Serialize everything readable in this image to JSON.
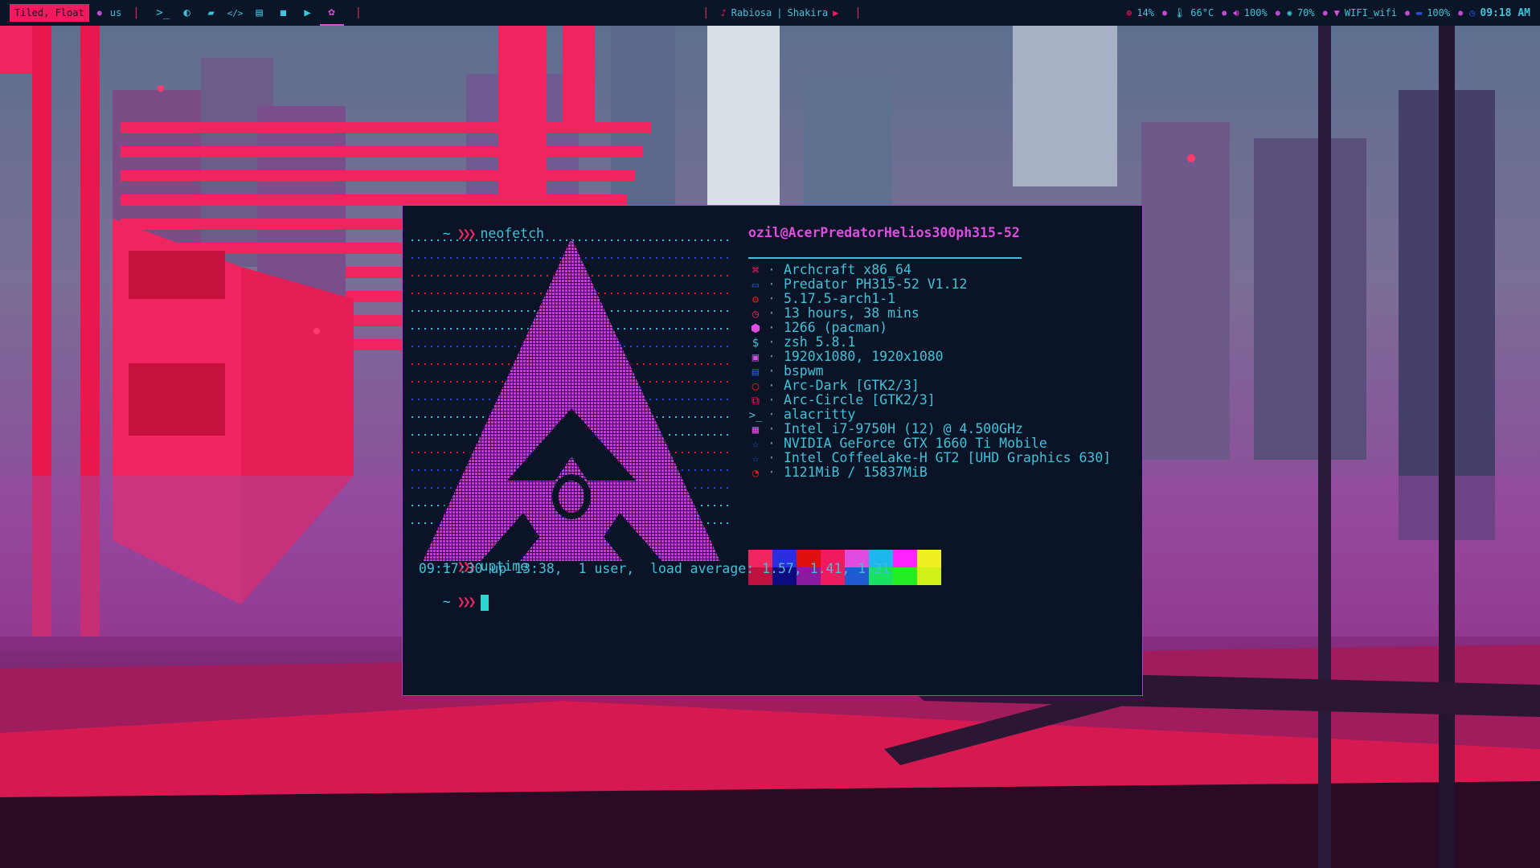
{
  "topbar": {
    "layout_mode": "Tiled, Float",
    "keyboard": "us",
    "workspaces": [
      {
        "icon": "terminal-icon",
        "glyph": ">_"
      },
      {
        "icon": "firefox-icon",
        "glyph": "◐"
      },
      {
        "icon": "folder-icon",
        "glyph": "▰"
      },
      {
        "icon": "code-icon",
        "glyph": "</>"
      },
      {
        "icon": "book-icon",
        "glyph": "▤"
      },
      {
        "icon": "chat-icon",
        "glyph": "◼"
      },
      {
        "icon": "youtube-icon",
        "glyph": "▶"
      },
      {
        "icon": "gear-icon",
        "glyph": "✿"
      }
    ],
    "music": {
      "song": "Rabiosa",
      "artist": "Shakira"
    },
    "cpu": "14%",
    "temperature": "66°C",
    "volume": "100%",
    "brightness": "70%",
    "wifi": "WIFI_wifi",
    "battery": "100%",
    "time": "09:18 AM",
    "colors": {
      "accent_pink": "#f01a5e",
      "accent_cyan": "#3fc2d8",
      "accent_magenta": "#e04be0",
      "bar_bg": "#0a1627"
    }
  },
  "terminal": {
    "prompt_tilde": "~",
    "prompt_arrows": "❯❯❯",
    "command1": "neofetch",
    "userhost": "ozil@AcerPredatorHelios300ph315-52",
    "info": [
      {
        "icon": "command-icon",
        "glyph": "⌘",
        "color": "#e0245e",
        "text": "Archcraft x86_64"
      },
      {
        "icon": "monitor-icon",
        "glyph": "▭",
        "color": "#2a5ce0",
        "text": "Predator PH315-52 V1.12"
      },
      {
        "icon": "gear-icon",
        "glyph": "⚙",
        "color": "#e01b1b",
        "text": "5.17.5-arch1-1"
      },
      {
        "icon": "clock-icon",
        "glyph": "◷",
        "color": "#e0245e",
        "text": "13 hours, 38 mins"
      },
      {
        "icon": "package-icon",
        "glyph": "⬢",
        "color": "#e04be0",
        "text": "1266 (pacman)"
      },
      {
        "icon": "dollar-icon",
        "glyph": "$",
        "color": "#3fc2d8",
        "text": "zsh 5.8.1"
      },
      {
        "icon": "image-icon",
        "glyph": "▣",
        "color": "#e04be0",
        "text": "1920x1080, 1920x1080"
      },
      {
        "icon": "window-icon",
        "glyph": "▤",
        "color": "#2a5ce0",
        "text": "bspwm"
      },
      {
        "icon": "drop-icon",
        "glyph": "◯",
        "color": "#e01b1b",
        "text": "Arc-Dark [GTK2/3]"
      },
      {
        "icon": "copy-icon",
        "glyph": "⧉",
        "color": "#e0245e",
        "text": "Arc-Circle [GTK2/3]"
      },
      {
        "icon": "terminal-icon",
        "glyph": ">_",
        "color": "#3fc2d8",
        "text": "alacritty"
      },
      {
        "icon": "cpu-icon",
        "glyph": "▦",
        "color": "#e04be0",
        "text": "Intel i7-9750H (12) @ 4.500GHz"
      },
      {
        "icon": "star-icon",
        "glyph": "☆",
        "color": "#2a5ce0",
        "text": "NVIDIA GeForce GTX 1660 Ti Mobile"
      },
      {
        "icon": "star-icon",
        "glyph": "☆",
        "color": "#2a5ce0",
        "text": "Intel CoffeeLake-H GT2 [UHD Graphics 630]"
      },
      {
        "icon": "pie-icon",
        "glyph": "◔",
        "color": "#e01b1b",
        "text": "1121MiB / 15837MiB"
      }
    ],
    "palette_top": [
      "#f0245e",
      "#2a2ee0",
      "#e01010",
      "#f01a5e",
      "#e04be0",
      "#1fb6f0",
      "#ff22ff",
      "#f0f020"
    ],
    "palette_bottom": [
      "#c01240",
      "#0c0c80",
      "#8a1aa0",
      "#f01a5e",
      "#1f5ad0",
      "#18e060",
      "#22ee22",
      "#d0f018"
    ],
    "command2": "uptime",
    "uptime_output": " 09:17:30 up 13:38,  1 user,  load average: 1.57, 1.41, 1.21"
  }
}
